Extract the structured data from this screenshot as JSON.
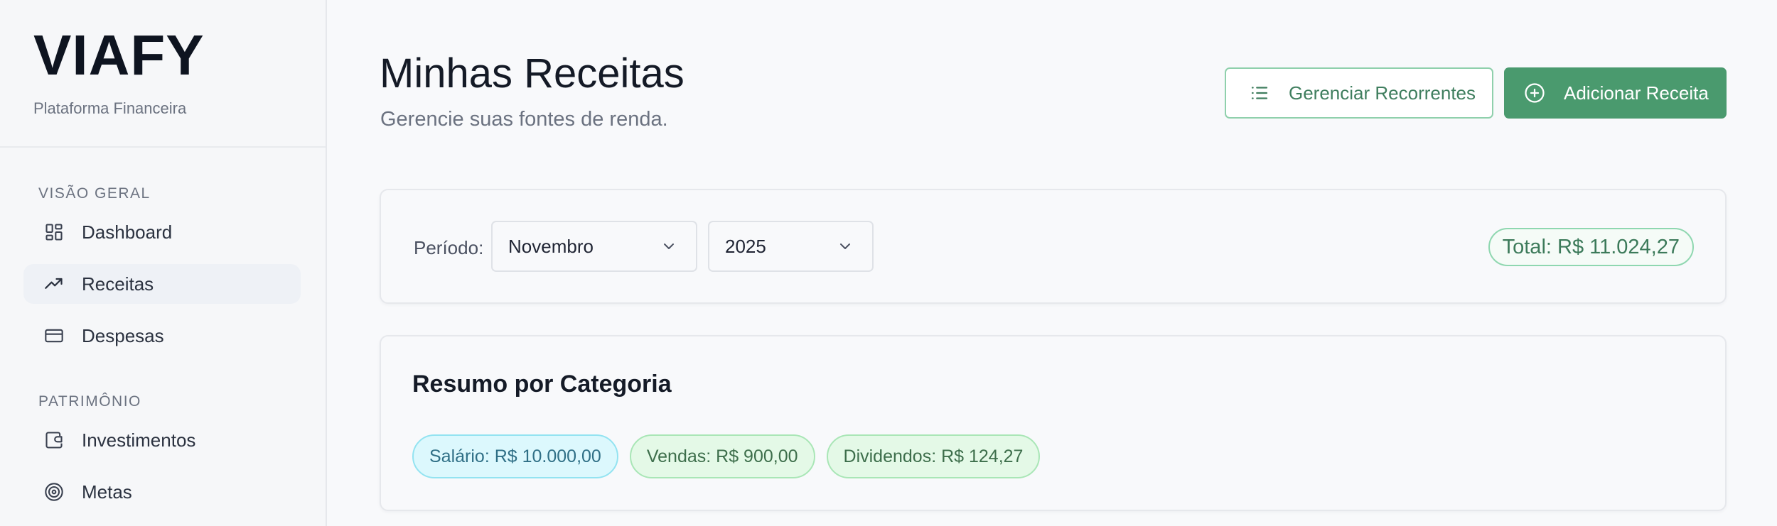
{
  "brand": {
    "name": "VIAFY",
    "subtitle": "Plataforma Financeira"
  },
  "sidebar": {
    "sections": [
      {
        "heading": "VISÃO GERAL",
        "items": [
          {
            "label": "Dashboard",
            "icon": "dashboard-grid-icon",
            "active": false
          },
          {
            "label": "Receitas",
            "icon": "trending-up-icon",
            "active": true
          },
          {
            "label": "Despesas",
            "icon": "credit-card-icon",
            "active": false
          }
        ]
      },
      {
        "heading": "PATRIMÔNIO",
        "items": [
          {
            "label": "Investimentos",
            "icon": "wallet-icon",
            "active": false
          },
          {
            "label": "Metas",
            "icon": "target-icon",
            "active": false
          }
        ]
      }
    ]
  },
  "header": {
    "title": "Minhas Receitas",
    "subtitle": "Gerencie suas fontes de renda.",
    "manage_recurring_label": "Gerenciar Recorrentes",
    "manage_recurring_icon": "list-icon",
    "add_income_label": "Adicionar Receita",
    "add_income_icon": "plus-circle-icon"
  },
  "filter": {
    "period_label": "Período:",
    "month": "Novembro",
    "year": "2025",
    "total": "Total: R$ 11.024,27"
  },
  "summary": {
    "title": "Resumo por Categoria",
    "chips": [
      {
        "label": "Salário: R$ 10.000,00",
        "bg": "#dcf8fd",
        "border": "#93e3f1",
        "color": "#2f6f86"
      },
      {
        "label": "Vendas: R$ 900,00",
        "bg": "#e4f9e7",
        "border": "#a9e6b6",
        "color": "#3d6e4b"
      },
      {
        "label": "Dividendos: R$ 124,27",
        "bg": "#e4f9e7",
        "border": "#a9e6b6",
        "color": "#3d6e4b"
      }
    ]
  },
  "colors": {
    "accent": "#4a9a6e",
    "accent_border": "#8fd0ac",
    "active_nav_bg": "#eef1f6"
  }
}
